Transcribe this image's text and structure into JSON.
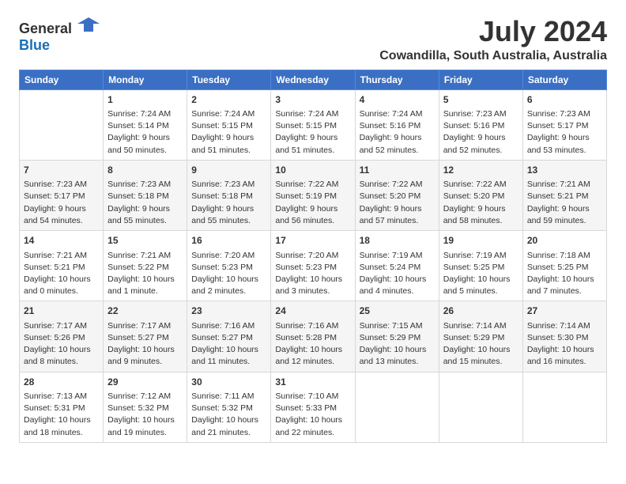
{
  "logo": {
    "general": "General",
    "blue": "Blue"
  },
  "title": "July 2024",
  "subtitle": "Cowandilla, South Australia, Australia",
  "headers": [
    "Sunday",
    "Monday",
    "Tuesday",
    "Wednesday",
    "Thursday",
    "Friday",
    "Saturday"
  ],
  "weeks": [
    [
      {
        "day": "",
        "info": ""
      },
      {
        "day": "1",
        "info": "Sunrise: 7:24 AM\nSunset: 5:14 PM\nDaylight: 9 hours\nand 50 minutes."
      },
      {
        "day": "2",
        "info": "Sunrise: 7:24 AM\nSunset: 5:15 PM\nDaylight: 9 hours\nand 51 minutes."
      },
      {
        "day": "3",
        "info": "Sunrise: 7:24 AM\nSunset: 5:15 PM\nDaylight: 9 hours\nand 51 minutes."
      },
      {
        "day": "4",
        "info": "Sunrise: 7:24 AM\nSunset: 5:16 PM\nDaylight: 9 hours\nand 52 minutes."
      },
      {
        "day": "5",
        "info": "Sunrise: 7:23 AM\nSunset: 5:16 PM\nDaylight: 9 hours\nand 52 minutes."
      },
      {
        "day": "6",
        "info": "Sunrise: 7:23 AM\nSunset: 5:17 PM\nDaylight: 9 hours\nand 53 minutes."
      }
    ],
    [
      {
        "day": "7",
        "info": "Sunrise: 7:23 AM\nSunset: 5:17 PM\nDaylight: 9 hours\nand 54 minutes."
      },
      {
        "day": "8",
        "info": "Sunrise: 7:23 AM\nSunset: 5:18 PM\nDaylight: 9 hours\nand 55 minutes."
      },
      {
        "day": "9",
        "info": "Sunrise: 7:23 AM\nSunset: 5:18 PM\nDaylight: 9 hours\nand 55 minutes."
      },
      {
        "day": "10",
        "info": "Sunrise: 7:22 AM\nSunset: 5:19 PM\nDaylight: 9 hours\nand 56 minutes."
      },
      {
        "day": "11",
        "info": "Sunrise: 7:22 AM\nSunset: 5:20 PM\nDaylight: 9 hours\nand 57 minutes."
      },
      {
        "day": "12",
        "info": "Sunrise: 7:22 AM\nSunset: 5:20 PM\nDaylight: 9 hours\nand 58 minutes."
      },
      {
        "day": "13",
        "info": "Sunrise: 7:21 AM\nSunset: 5:21 PM\nDaylight: 9 hours\nand 59 minutes."
      }
    ],
    [
      {
        "day": "14",
        "info": "Sunrise: 7:21 AM\nSunset: 5:21 PM\nDaylight: 10 hours\nand 0 minutes."
      },
      {
        "day": "15",
        "info": "Sunrise: 7:21 AM\nSunset: 5:22 PM\nDaylight: 10 hours\nand 1 minute."
      },
      {
        "day": "16",
        "info": "Sunrise: 7:20 AM\nSunset: 5:23 PM\nDaylight: 10 hours\nand 2 minutes."
      },
      {
        "day": "17",
        "info": "Sunrise: 7:20 AM\nSunset: 5:23 PM\nDaylight: 10 hours\nand 3 minutes."
      },
      {
        "day": "18",
        "info": "Sunrise: 7:19 AM\nSunset: 5:24 PM\nDaylight: 10 hours\nand 4 minutes."
      },
      {
        "day": "19",
        "info": "Sunrise: 7:19 AM\nSunset: 5:25 PM\nDaylight: 10 hours\nand 5 minutes."
      },
      {
        "day": "20",
        "info": "Sunrise: 7:18 AM\nSunset: 5:25 PM\nDaylight: 10 hours\nand 7 minutes."
      }
    ],
    [
      {
        "day": "21",
        "info": "Sunrise: 7:17 AM\nSunset: 5:26 PM\nDaylight: 10 hours\nand 8 minutes."
      },
      {
        "day": "22",
        "info": "Sunrise: 7:17 AM\nSunset: 5:27 PM\nDaylight: 10 hours\nand 9 minutes."
      },
      {
        "day": "23",
        "info": "Sunrise: 7:16 AM\nSunset: 5:27 PM\nDaylight: 10 hours\nand 11 minutes."
      },
      {
        "day": "24",
        "info": "Sunrise: 7:16 AM\nSunset: 5:28 PM\nDaylight: 10 hours\nand 12 minutes."
      },
      {
        "day": "25",
        "info": "Sunrise: 7:15 AM\nSunset: 5:29 PM\nDaylight: 10 hours\nand 13 minutes."
      },
      {
        "day": "26",
        "info": "Sunrise: 7:14 AM\nSunset: 5:29 PM\nDaylight: 10 hours\nand 15 minutes."
      },
      {
        "day": "27",
        "info": "Sunrise: 7:14 AM\nSunset: 5:30 PM\nDaylight: 10 hours\nand 16 minutes."
      }
    ],
    [
      {
        "day": "28",
        "info": "Sunrise: 7:13 AM\nSunset: 5:31 PM\nDaylight: 10 hours\nand 18 minutes."
      },
      {
        "day": "29",
        "info": "Sunrise: 7:12 AM\nSunset: 5:32 PM\nDaylight: 10 hours\nand 19 minutes."
      },
      {
        "day": "30",
        "info": "Sunrise: 7:11 AM\nSunset: 5:32 PM\nDaylight: 10 hours\nand 21 minutes."
      },
      {
        "day": "31",
        "info": "Sunrise: 7:10 AM\nSunset: 5:33 PM\nDaylight: 10 hours\nand 22 minutes."
      },
      {
        "day": "",
        "info": ""
      },
      {
        "day": "",
        "info": ""
      },
      {
        "day": "",
        "info": ""
      }
    ]
  ]
}
